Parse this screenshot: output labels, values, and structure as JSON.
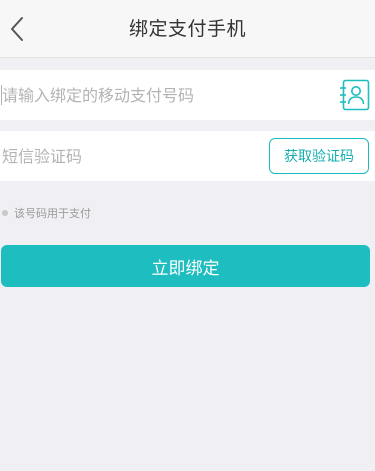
{
  "header": {
    "title": "绑定支付手机",
    "back_icon": "chevron-left-icon"
  },
  "phone": {
    "placeholder": "请输入绑定的移动支付号码",
    "value": "",
    "contact_icon": "contact-book-icon"
  },
  "code": {
    "placeholder": "短信验证码",
    "value": "",
    "get_code_label": "获取验证码"
  },
  "hint": {
    "text": "该号码用于支付"
  },
  "bind_button": {
    "label": "立即绑定"
  },
  "colors": {
    "accent": "#1ebdc0",
    "background": "#f0eff4",
    "header_bg": "#f7f7f7"
  }
}
